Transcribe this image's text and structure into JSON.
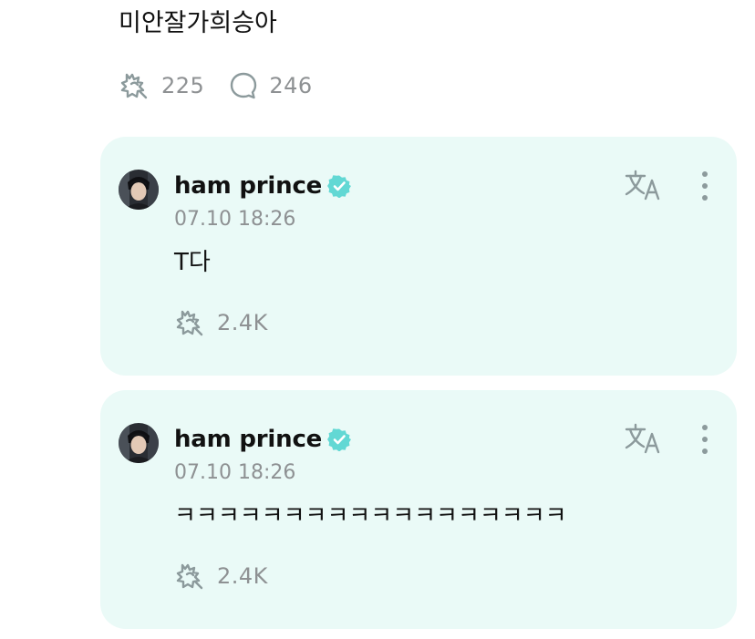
{
  "post": {
    "text": "미안잘가희승아",
    "reaction_count": "225",
    "comment_count": "246"
  },
  "replies": [
    {
      "author": "ham prince",
      "verified": true,
      "timestamp": "07.10 18:26",
      "text": "T다",
      "reaction_count": "2.4K"
    },
    {
      "author": "ham prince",
      "verified": true,
      "timestamp": "07.10 18:26",
      "text": "ㅋㅋㅋㅋㅋㅋㅋㅋㅋㅋㅋㅋㅋㅋㅋㅋㅋㅋ",
      "reaction_count": "2.4K"
    }
  ],
  "icons": {
    "reaction": "reaction-icon",
    "comment": "comment-icon",
    "verified": "verified-badge-icon",
    "translate": "translate-icon",
    "more": "more-options-icon"
  },
  "colors": {
    "card_background": "#eafaf7",
    "verified_badge": "#62d8d4",
    "muted_text": "#8e9193",
    "icon_gray": "#8c9a9c"
  }
}
